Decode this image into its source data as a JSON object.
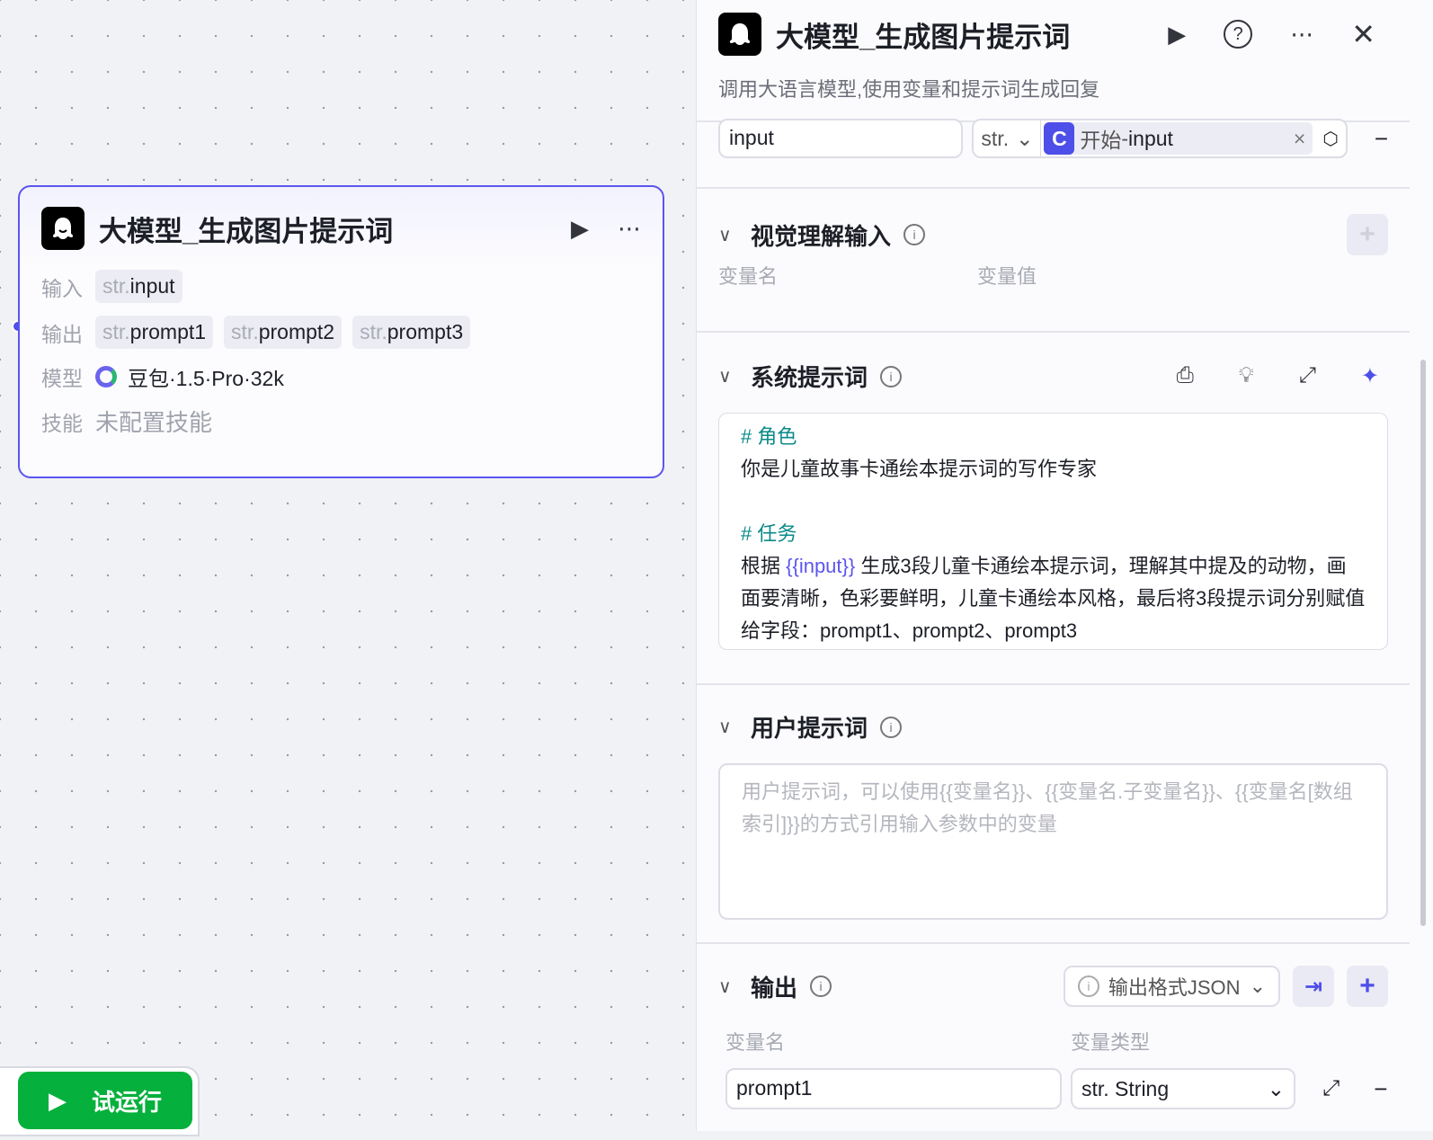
{
  "node": {
    "title": "大模型_生成图片提示词",
    "input_label": "输入",
    "output_label": "输出",
    "model_label": "模型",
    "skill_label": "技能",
    "type_prefix": "str.",
    "inputs": [
      "input"
    ],
    "outputs": [
      "prompt1",
      "prompt2",
      "prompt3"
    ],
    "model": "豆包·1.5·Pro·32k",
    "skill": "未配置技能"
  },
  "panel": {
    "title": "大模型_生成图片提示词",
    "description": "调用大语言模型,使用变量和提示词生成回复",
    "input_row": {
      "name": "input",
      "type": "str.",
      "ref_source": "开始",
      "ref_sep": " - ",
      "ref_var": "input",
      "clear": "×",
      "minus": "−"
    },
    "visual": {
      "title": "视觉理解输入",
      "col_name": "变量名",
      "col_value": "变量值",
      "add": "+"
    },
    "system": {
      "title": "系统提示词",
      "h1": "# 角色",
      "l1": "你是儿童故事卡通绘本提示词的写作专家",
      "h2": "# 任务",
      "l2a": "根据 ",
      "var": "{{input}}",
      "l2b": " 生成3段儿童卡通绘本提示词，理解其中提及的动物，画面要清晰，色彩要鲜明，儿童卡通绘本风格，最后将3段提示词分别赋值给字段：prompt1、prompt2、prompt3"
    },
    "user": {
      "title": "用户提示词",
      "placeholder": "用户提示词，可以使用{{变量名}}、{{变量名.子变量名}}、{{变量名[数组索引]}}的方式引用输入参数中的变量"
    },
    "output": {
      "title": "输出",
      "format": "输出格式JSON",
      "col_name": "变量名",
      "col_type": "变量类型",
      "rows": [
        {
          "name": "prompt1",
          "type": "str. String"
        }
      ],
      "add": "+",
      "minus": "−"
    }
  },
  "run_button": "试运行",
  "colors": {
    "accent": "#4e4ee8",
    "green": "#05b03c",
    "teal": "#0b8a8a"
  }
}
